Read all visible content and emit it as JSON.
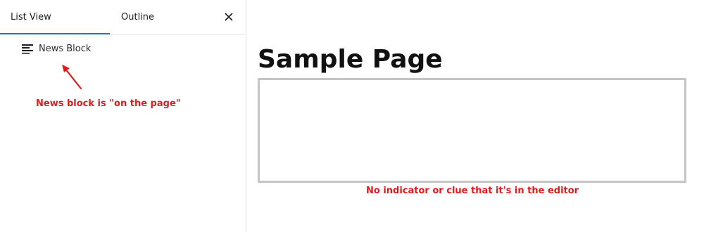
{
  "sidebar": {
    "tabs": [
      {
        "label": "List View",
        "active": true
      },
      {
        "label": "Outline",
        "active": false
      }
    ],
    "close_icon": "close-icon",
    "items": [
      {
        "label": "News Block",
        "icon": "block-align-left-icon"
      }
    ],
    "annotation": "News block is \"on the page\""
  },
  "editor": {
    "title": "Sample Page",
    "annotation": "No indicator or clue that it's in the editor"
  },
  "colors": {
    "accent": "#2f6fb3",
    "annotation": "#e01b1b",
    "block_border": "#c4c4c4"
  }
}
